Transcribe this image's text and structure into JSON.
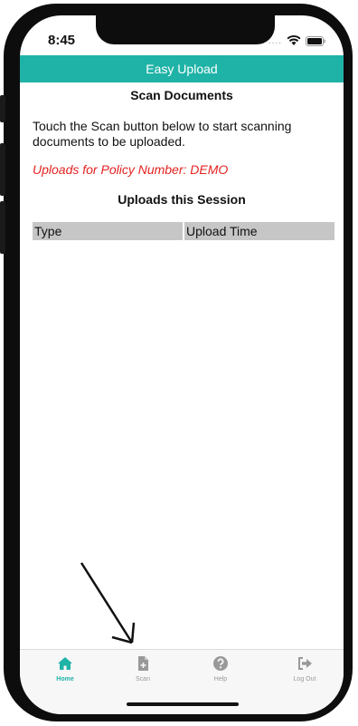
{
  "status_bar": {
    "time": "8:45",
    "signal_icon": "dots-icon",
    "wifi_icon": "wifi-icon",
    "battery_icon": "battery-icon"
  },
  "header": {
    "title": "Easy Upload"
  },
  "main": {
    "heading": "Scan Documents",
    "instructions": "Touch the Scan button below to start scanning documents to be uploaded.",
    "policy_text": "Uploads for Policy Number: DEMO",
    "session_heading": "Uploads this Session",
    "table": {
      "columns": [
        "Type",
        "Upload Time"
      ],
      "rows": []
    }
  },
  "tab_bar": {
    "items": [
      {
        "label": "Home",
        "icon": "home-icon",
        "active": true
      },
      {
        "label": "Scan",
        "icon": "document-plus-icon",
        "active": false
      },
      {
        "label": "Help",
        "icon": "question-icon",
        "active": false
      },
      {
        "label": "Log Out",
        "icon": "logout-icon",
        "active": false
      }
    ]
  },
  "colors": {
    "accent": "#1fb3a7",
    "policy_text": "#e52222",
    "table_header": "#c6c6c6"
  }
}
